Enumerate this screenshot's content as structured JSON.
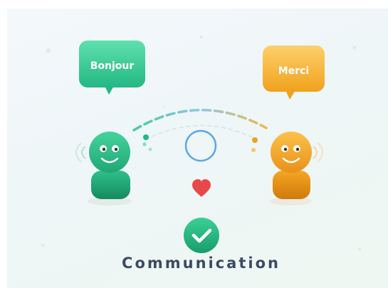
{
  "bubbles": {
    "left": "Bonjour",
    "right": "Merci"
  },
  "caption": "Communication",
  "icons": {
    "left_figure": "smiling-person-green",
    "right_figure": "smiling-person-orange",
    "center": "circle-outline",
    "heart": "heart",
    "check": "checkmark-circle"
  },
  "colors": {
    "green": "#2fc08a",
    "orange": "#f2a826",
    "heart": "#e84848",
    "ring": "#5ba6ea",
    "caption": "#3c4a63"
  }
}
